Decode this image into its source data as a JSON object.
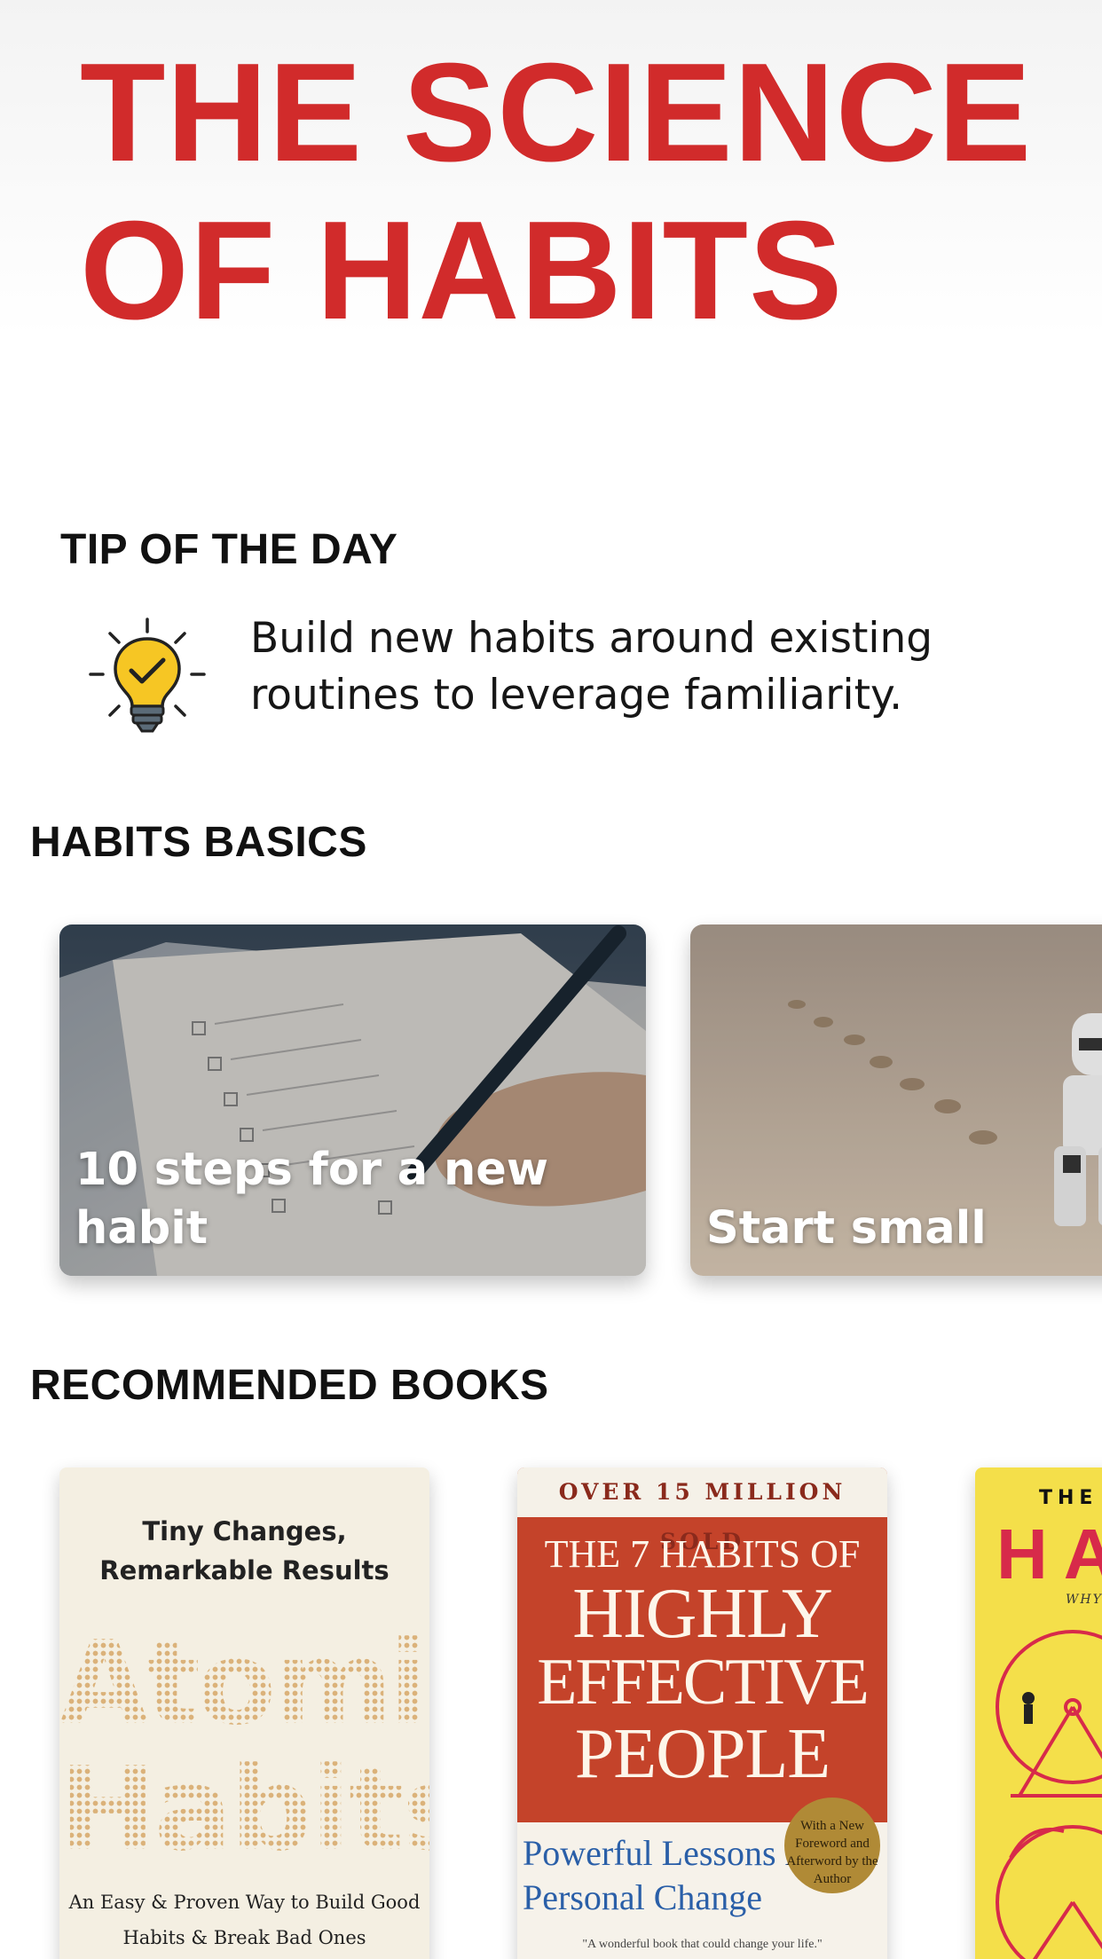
{
  "header": {
    "title": "THE SCIENCE OF HABITS"
  },
  "tip": {
    "heading": "TIP OF THE DAY",
    "icon": "lightbulb-check-icon",
    "text": "Build new habits around existing routines to leverage familiarity."
  },
  "basics": {
    "heading": "HABITS BASICS",
    "cards": [
      {
        "label": "10 steps for a new habit",
        "image": "writing-checklist-photo"
      },
      {
        "label": "Start small",
        "image": "toy-figure-footprints-photo"
      }
    ]
  },
  "books": {
    "heading": "RECOMMENDED BOOKS",
    "items": [
      {
        "tagline": "Tiny Changes, Remarkable Results",
        "title_line1": "Atomic",
        "title_line2": "Habits",
        "subtitle": "An Easy & Proven Way to Build Good Habits & Break Bad Ones"
      },
      {
        "banner": "OVER 15 MILLION SOLD",
        "title_line1": "THE 7 HABITS OF",
        "title_line2": "HIGHLY",
        "title_line3": "EFFECTIVE",
        "title_line4": "PEOPLE",
        "subtitle": "Powerful Lessons in Personal Change",
        "seal": "With a New Foreword and Afterword by the Author",
        "quote": "\"A wonderful book that could change your life.\""
      },
      {
        "title_small": "THE",
        "title_big": "HA",
        "sub": "WHY IN L"
      }
    ]
  },
  "colors": {
    "accent": "#d12b2b",
    "text": "#111111",
    "icon_bulb": "#f6c624"
  }
}
